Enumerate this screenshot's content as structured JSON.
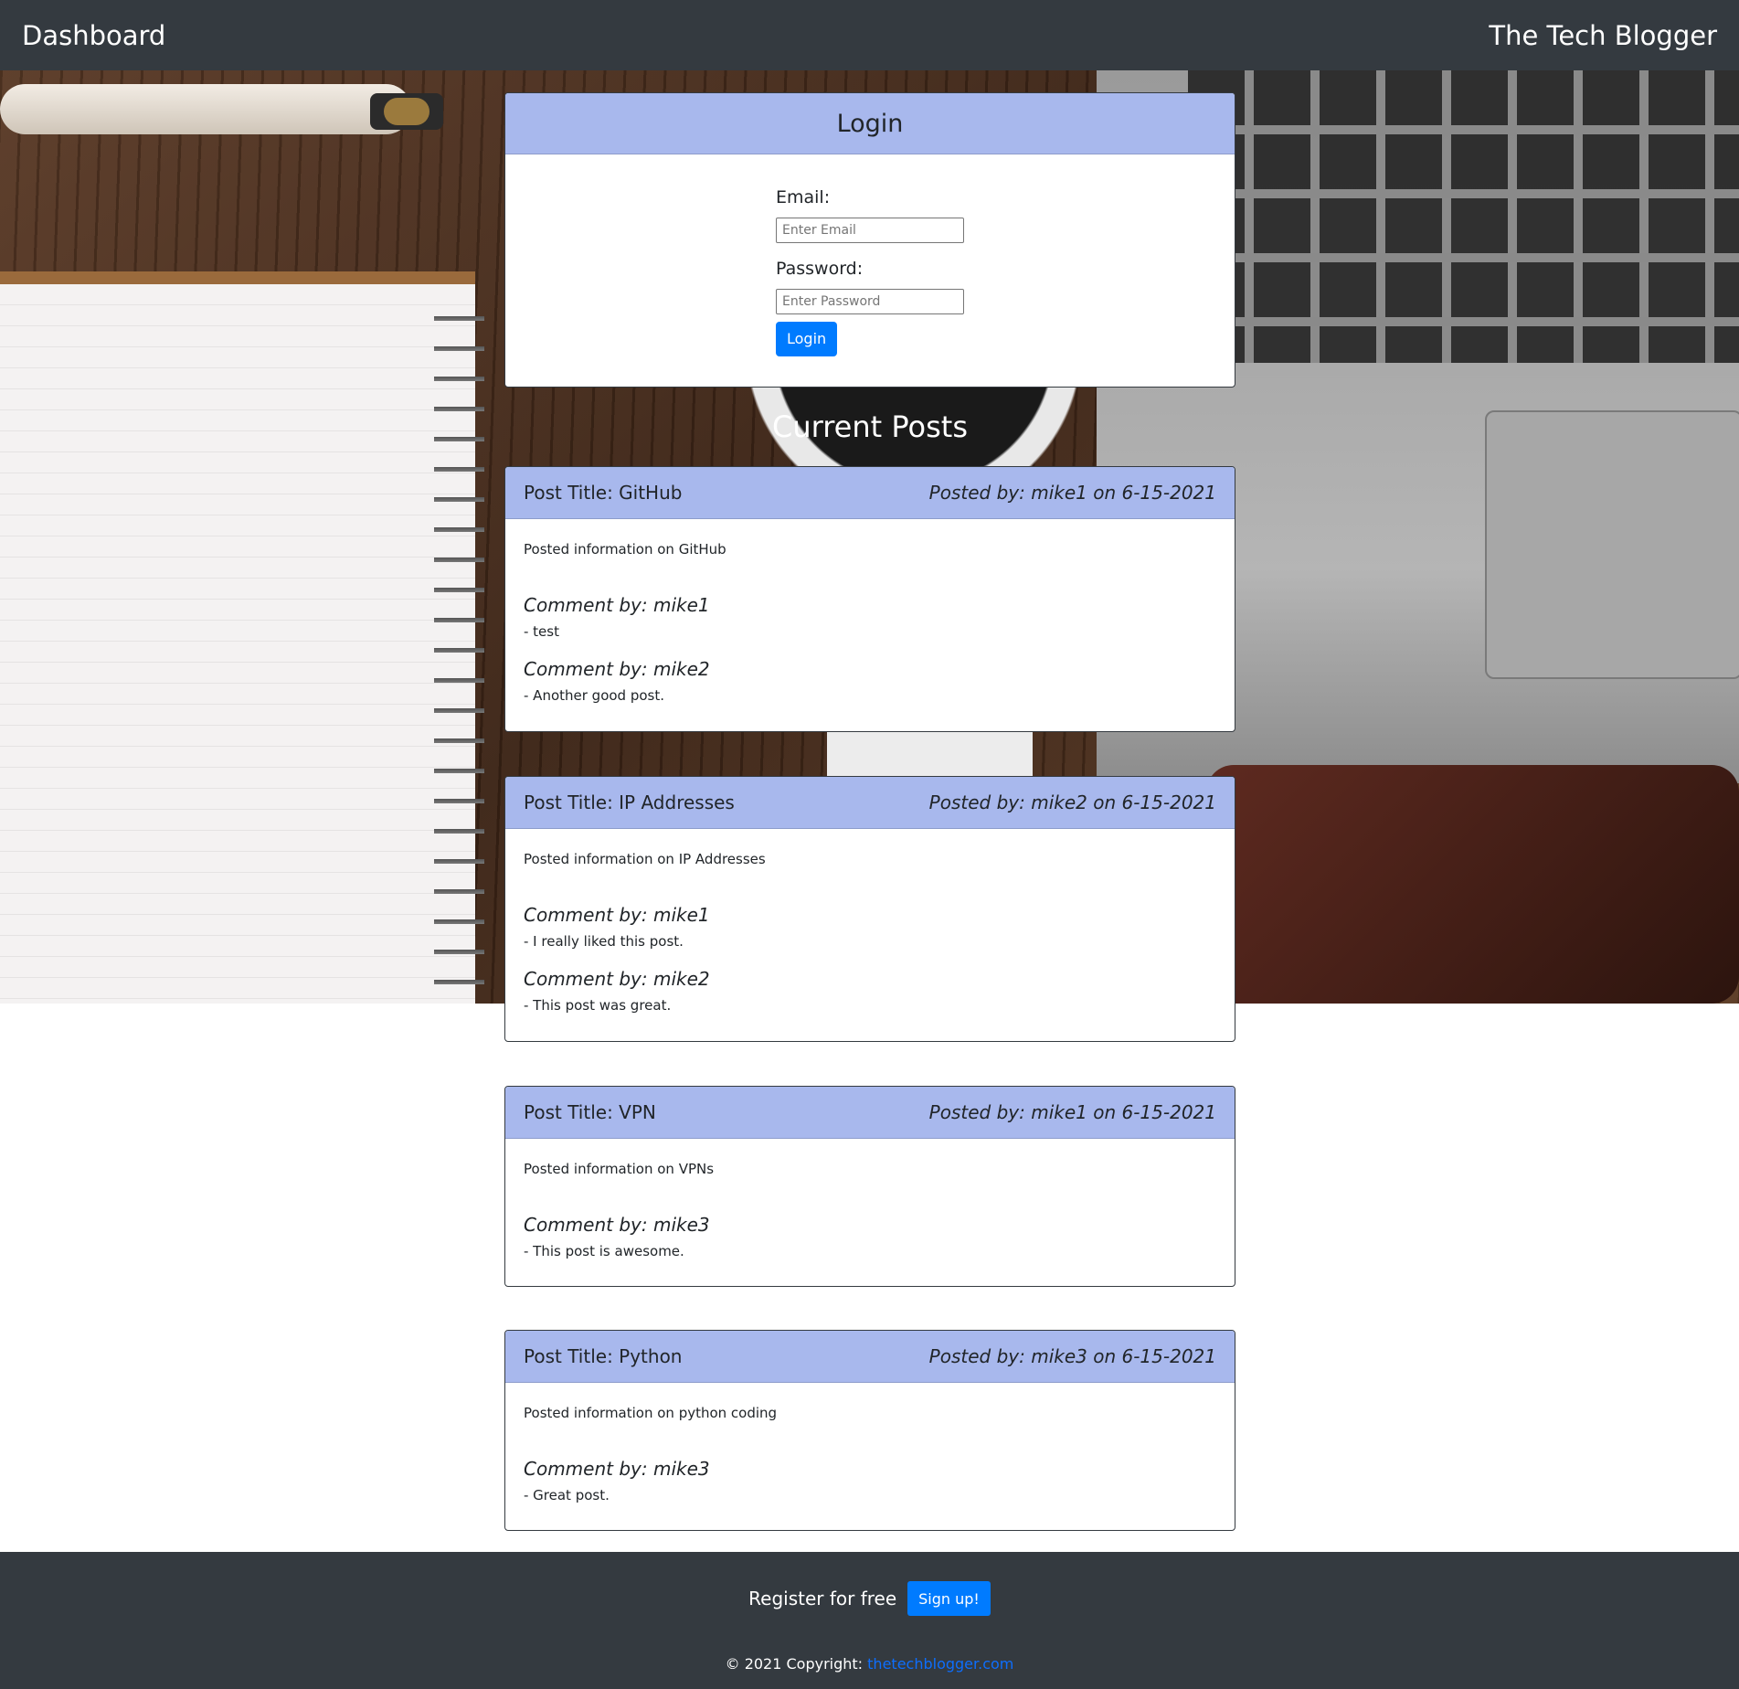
{
  "nav": {
    "left_title": "Dashboard",
    "brand": "The Tech Blogger"
  },
  "login": {
    "title": "Login",
    "email_label": "Email:",
    "email_placeholder": "Enter Email",
    "password_label": "Password:",
    "password_placeholder": "Enter Password",
    "button_label": "Login"
  },
  "posts_heading": "Current Posts",
  "posts": [
    {
      "title": "Post Title: GitHub",
      "meta": "Posted by: mike1 on 6-15-2021",
      "content": "Posted information on GitHub",
      "comments": [
        {
          "author": "Comment by: mike1",
          "text": "- test"
        },
        {
          "author": "Comment by: mike2",
          "text": "- Another good post."
        }
      ]
    },
    {
      "title": "Post Title: IP Addresses",
      "meta": "Posted by: mike2 on 6-15-2021",
      "content": "Posted information on IP Addresses",
      "comments": [
        {
          "author": "Comment by: mike1",
          "text": "- I really liked this post."
        },
        {
          "author": "Comment by: mike2",
          "text": "- This post was great."
        }
      ]
    },
    {
      "title": "Post Title: VPN",
      "meta": "Posted by: mike1 on 6-15-2021",
      "content": "Posted information on VPNs",
      "comments": [
        {
          "author": "Comment by: mike3",
          "text": "- This post is awesome."
        }
      ]
    },
    {
      "title": "Post Title: Python",
      "meta": "Posted by: mike3 on 6-15-2021",
      "content": "Posted information on python coding",
      "comments": [
        {
          "author": "Comment by: mike3",
          "text": "- Great post."
        }
      ]
    }
  ],
  "footer": {
    "register_text": "Register for free",
    "signup_label": "Sign up!",
    "copyright_prefix": "© 2021 Copyright: ",
    "copyright_link": "thetechblogger.com"
  },
  "colors": {
    "navbar_bg": "#343a40",
    "card_header_bg": "#a8b8ed",
    "button_primary": "#007bff"
  }
}
